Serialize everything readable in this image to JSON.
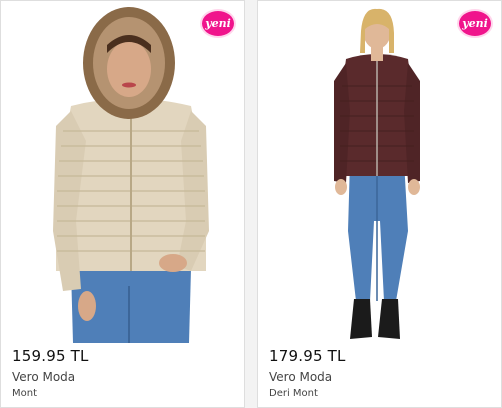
{
  "products": [
    {
      "badge": "yeni",
      "price": "159.95 TL",
      "brand": "Vero Moda",
      "category": "Mont"
    },
    {
      "badge": "yeni",
      "price": "179.95 TL",
      "brand": "Vero Moda",
      "category": "Deri Mont"
    }
  ],
  "colors": {
    "badge": "#f0148c",
    "jacket_1": "#e2d6bf",
    "jacket_2": "#5a2a2c",
    "jeans": "#4f7fb8"
  }
}
